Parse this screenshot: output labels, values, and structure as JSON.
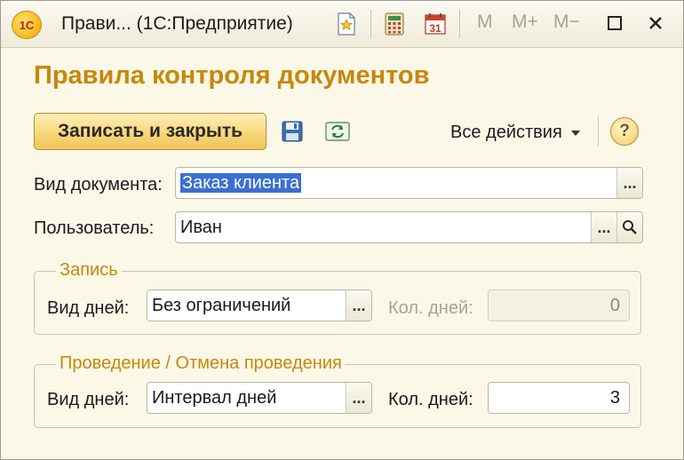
{
  "window": {
    "app_logo": "1С",
    "title": "Прави...  (1С:Предприятие)",
    "memory_buttons": [
      "M",
      "M+",
      "M−"
    ]
  },
  "form": {
    "title": "Правила контроля документов",
    "save_close_label": "Записать и закрыть",
    "all_actions_label": "Все действия",
    "help_label": "?"
  },
  "fields": {
    "doc_type_label": "Вид документа:",
    "doc_type_value": "Заказ клиента",
    "user_label": "Пользователь:",
    "user_value": "Иван",
    "select_button": "..."
  },
  "groups": {
    "record": {
      "title": "Запись",
      "days_type_label": "Вид дней:",
      "days_type_value": "Без ограничений",
      "days_count_label": "Кол. дней:",
      "days_count_value": "0"
    },
    "posting": {
      "title": "Проведение / Отмена проведения",
      "days_type_label": "Вид дней:",
      "days_type_value": "Интервал дней",
      "days_count_label": "Кол. дней:",
      "days_count_value": "3"
    }
  },
  "colors": {
    "accent": "#c8870a",
    "selection": "#3b6fd0",
    "window_bg": "#fbf8e8"
  }
}
